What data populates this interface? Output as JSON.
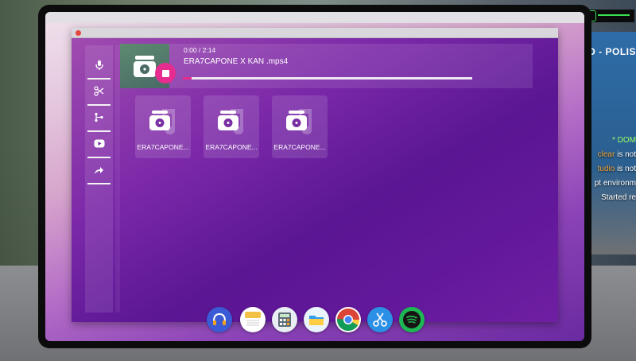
{
  "player": {
    "time": "0:00 / 2:14",
    "track_title": "ERA7CAPONE X KAN .mps4",
    "progress": 0.03
  },
  "sidebar": {
    "items": [
      {
        "name": "microphone-icon"
      },
      {
        "name": "scissors-icon"
      },
      {
        "name": "branch-icon"
      },
      {
        "name": "youtube-icon"
      },
      {
        "name": "share-icon"
      }
    ]
  },
  "files": [
    {
      "label": "ERA7CAPONE..."
    },
    {
      "label": "ERA7CAPONE..."
    },
    {
      "label": "ERA7CAPONE..."
    }
  ],
  "dock": {
    "apps": [
      {
        "name": "headphones-music-app-icon",
        "color": "#3b5bd6"
      },
      {
        "name": "notes-app-icon",
        "color": "#f2c044"
      },
      {
        "name": "calculator-app-icon",
        "color": "#5c6b74"
      },
      {
        "name": "files-app-icon",
        "color": "#2c9df0"
      },
      {
        "name": "chrome-app-icon",
        "color": "#db4437"
      },
      {
        "name": "scissors-editor-app-icon",
        "color": "#2b8fe6"
      },
      {
        "name": "spotify-app-icon",
        "color": "#1db954"
      }
    ]
  },
  "hud": {
    "banner": "D - POLIS",
    "dom": "* DOM",
    "lines": [
      {
        "prefix": "clear",
        "text": " is not"
      },
      {
        "prefix": "tudio",
        "text": " is not"
      },
      {
        "prefix": "",
        "text": "pt environm"
      },
      {
        "prefix": "",
        "text": "Started re"
      }
    ]
  },
  "colors": {
    "accent": "#e62d8f",
    "window_gradient_top": "#a14db0",
    "window_gradient_bottom": "#5a1693"
  }
}
